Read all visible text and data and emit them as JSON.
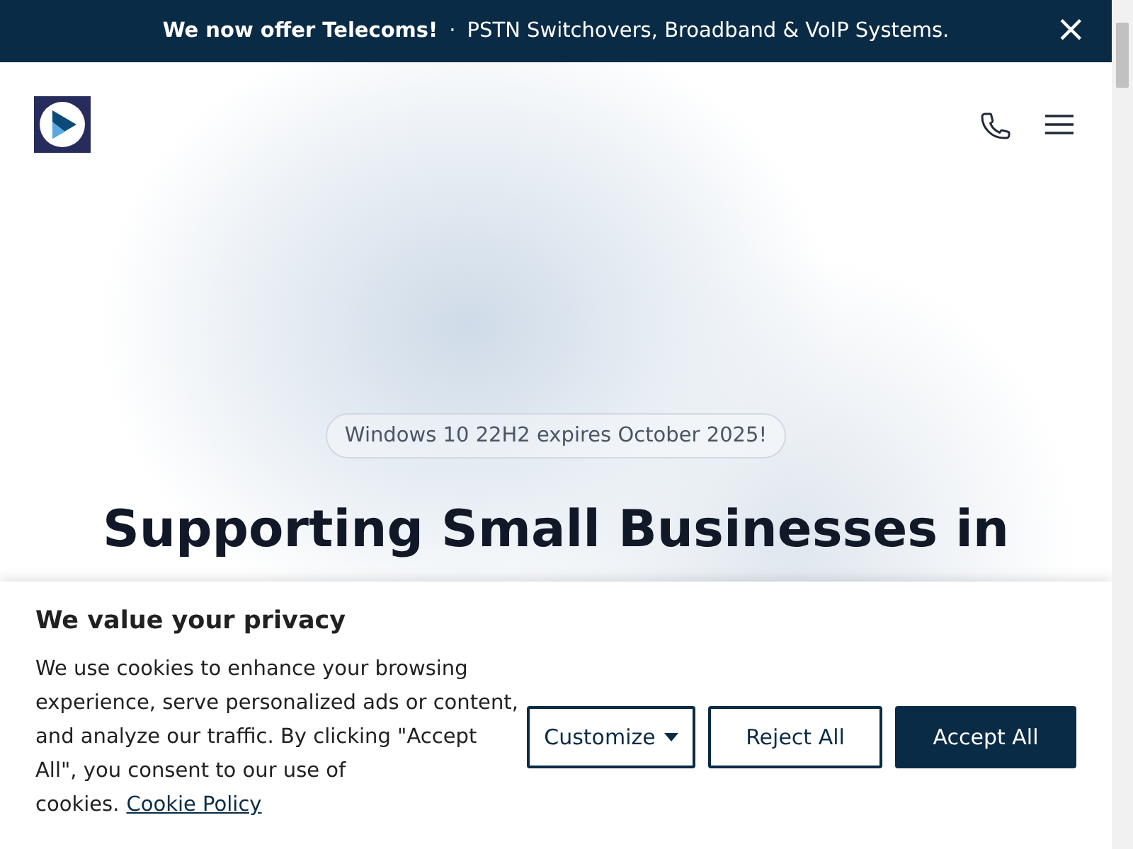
{
  "announcement": {
    "highlight": "We now offer Telecoms!",
    "separator": "·",
    "text": "PSTN Switchovers, Broadband & VoIP Systems.",
    "close": "×"
  },
  "hero": {
    "badge": "Windows 10 22H2 expires October 2025!",
    "heading": "Supporting Small Businesses in"
  },
  "cookie_banner": {
    "title": "We value your privacy",
    "text": "We use cookies to enhance your browsing experience, serve personalized ads or content, and analyze our traffic. By clicking \"Accept All\", you consent to our use of cookies.",
    "link": "Cookie Policy",
    "buttons": [
      {
        "label": "Customize",
        "kind": "dropdown"
      },
      {
        "label": "Reject All",
        "kind": "outline"
      },
      {
        "label": "Accept All",
        "kind": "primary"
      }
    ]
  }
}
